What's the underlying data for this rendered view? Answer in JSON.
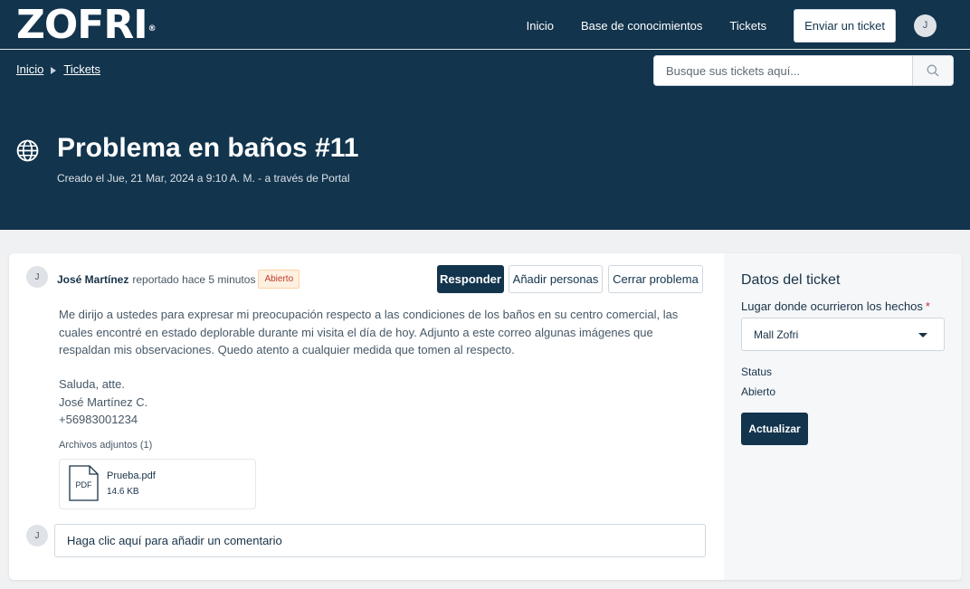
{
  "brand": {
    "logo_text": "ZOFRI",
    "registered_mark": "®"
  },
  "nav": {
    "items": [
      {
        "label": "Inicio"
      },
      {
        "label": "Base de conocimientos"
      },
      {
        "label": "Tickets"
      }
    ],
    "send_ticket_label": "Enviar un ticket",
    "user_initial": "J"
  },
  "breadcrumb": [
    {
      "label": "Inicio"
    },
    {
      "label": "Tickets"
    }
  ],
  "search": {
    "placeholder": "Busque sus tickets aquí...",
    "value": ""
  },
  "ticket": {
    "title": "Problema en baños #11",
    "created": "Creado el Jue, 21 Mar, 2024 a 9:10 A. M. - a través de Portal"
  },
  "conversation": {
    "author_initial": "J",
    "author": "José Martínez",
    "reported_text": "reportado hace 5 minutos",
    "status_badge": "Abierto",
    "actions": {
      "reply": "Responder",
      "add_people": "Añadir personas",
      "close_problem": "Cerrar problema"
    },
    "message": "Me dirijo a ustedes para expresar mi preocupación respecto a las condiciones de los baños en su centro comercial, las cuales encontré en estado deplorable durante mi visita el día de hoy. Adjunto a este correo algunas imágenes que respaldan mis observaciones. Quedo atento a cualquier medida que tomen al respecto.",
    "signature": [
      "Saluda, atte.",
      "José Martínez C.",
      "+56983001234"
    ],
    "attachments_label": "Archivos adjuntos (1)",
    "attachment": {
      "icon_label": "PDF",
      "name": "Prueba.pdf",
      "size": "14.6 KB"
    },
    "comment_initial": "J",
    "comment_placeholder": "Haga clic aquí para añadir un comentario"
  },
  "ticket_data": {
    "heading": "Datos del ticket",
    "location_label": "Lugar donde ocurrieron los hechos",
    "required_mark": "*",
    "location_value": "Mall Zofri",
    "status_label": "Status",
    "status_value": "Abierto",
    "update_label": "Actualizar"
  },
  "colors": {
    "header_bg": "#12344d",
    "page_bg": "#f0f1f3",
    "badge_bg": "#fef1e1",
    "badge_text": "#c0392b",
    "required": "#d72d30"
  }
}
